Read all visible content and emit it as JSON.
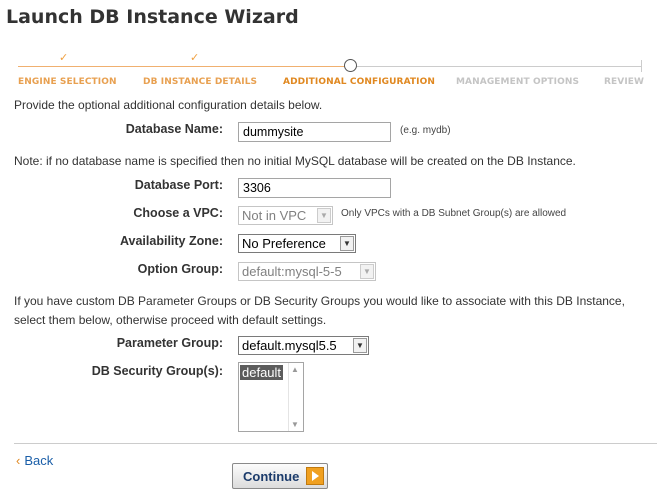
{
  "title": "Launch DB Instance Wizard",
  "steps": [
    {
      "label": "ENGINE SELECTION",
      "state": "done"
    },
    {
      "label": "DB INSTANCE DETAILS",
      "state": "done"
    },
    {
      "label": "ADDITIONAL CONFIGURATION",
      "state": "current"
    },
    {
      "label": "MANAGEMENT OPTIONS",
      "state": "todo"
    },
    {
      "label": "REVIEW",
      "state": "todo"
    }
  ],
  "intro": "Provide the optional additional configuration details below.",
  "database_name": {
    "label": "Database Name:",
    "value": "dummysite",
    "hint": "(e.g. mydb)"
  },
  "note": "Note: if no database name is specified then no initial MySQL database will be created on the DB Instance.",
  "database_port": {
    "label": "Database Port:",
    "value": "3306"
  },
  "vpc": {
    "label": "Choose a VPC:",
    "value": "Not in VPC",
    "hint": "Only VPCs with a DB Subnet Group(s) are allowed"
  },
  "availability_zone": {
    "label": "Availability Zone:",
    "value": "No Preference"
  },
  "option_group": {
    "label": "Option Group:",
    "value": "default:mysql-5-5"
  },
  "custom_line1": "If you have custom DB Parameter Groups or DB Security Groups you would like to associate with this DB Instance,",
  "custom_line2": "select them below, otherwise proceed with default settings.",
  "parameter_group": {
    "label": "Parameter Group:",
    "value": "default.mysql5.5"
  },
  "security_groups": {
    "label": "DB Security Group(s):",
    "options": [
      "default"
    ]
  },
  "back_label": "Back",
  "continue_label": "Continue",
  "icons": {
    "step_done": "checkmark-icon",
    "back": "chevron-left-icon",
    "continue": "arrow-right-icon",
    "dropdown": "chevron-down-icon"
  },
  "colors": {
    "accent": "#e08820",
    "link": "#1a5ea8",
    "button_text": "#1b3b6b"
  }
}
